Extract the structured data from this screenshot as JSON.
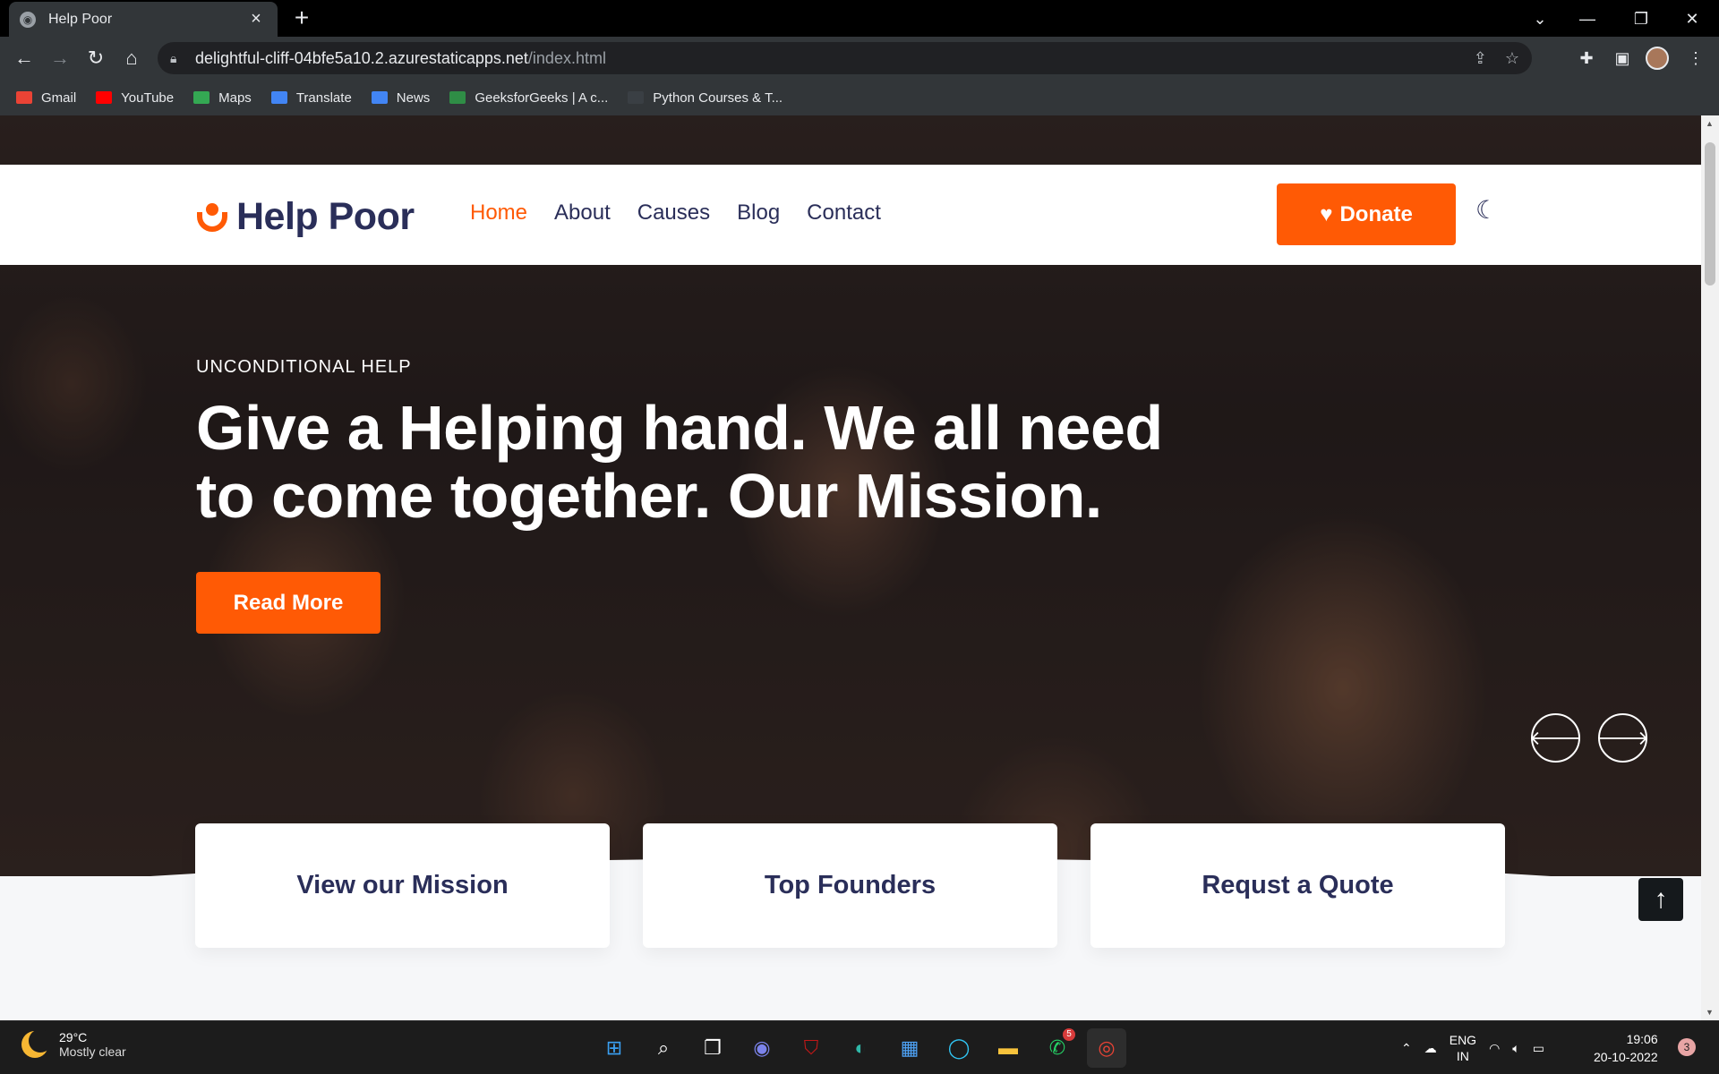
{
  "browser": {
    "tab_title": "Help Poor",
    "url_host": "delightful-cliff-04bfe5a10.2.azurestaticapps.net",
    "url_path": "/index.html",
    "bookmarks": [
      {
        "label": "Gmail",
        "color": "#ea4335"
      },
      {
        "label": "YouTube",
        "color": "#ff0000"
      },
      {
        "label": "Maps",
        "color": "#34a853"
      },
      {
        "label": "Translate",
        "color": "#4285f4"
      },
      {
        "label": "News",
        "color": "#4285f4"
      },
      {
        "label": "GeeksforGeeks | A c...",
        "color": "#2f8d46"
      },
      {
        "label": "Python Courses & T...",
        "color": "#3a3f44"
      }
    ]
  },
  "site": {
    "logo_text": "Help Poor",
    "nav": [
      "Home",
      "About",
      "Causes",
      "Blog",
      "Contact"
    ],
    "active_nav": "Home",
    "donate_label": "Donate",
    "hero": {
      "eyebrow": "UNCONDITIONAL HELP",
      "headline": "Give a Helping hand. We all need to come together. Our Mission.",
      "cta": "Read More"
    },
    "features": [
      "View our Mission",
      "Top Founders",
      "Requst a Quote"
    ],
    "colors": {
      "accent": "#ff5a05",
      "heading": "#2a2e59"
    }
  },
  "taskbar": {
    "temperature": "29°C",
    "weather": "Mostly clear",
    "lang_primary": "ENG",
    "lang_region": "IN",
    "time": "19:06",
    "date": "20-10-2022",
    "whatsapp_badge": "5",
    "notification_count": "3"
  }
}
